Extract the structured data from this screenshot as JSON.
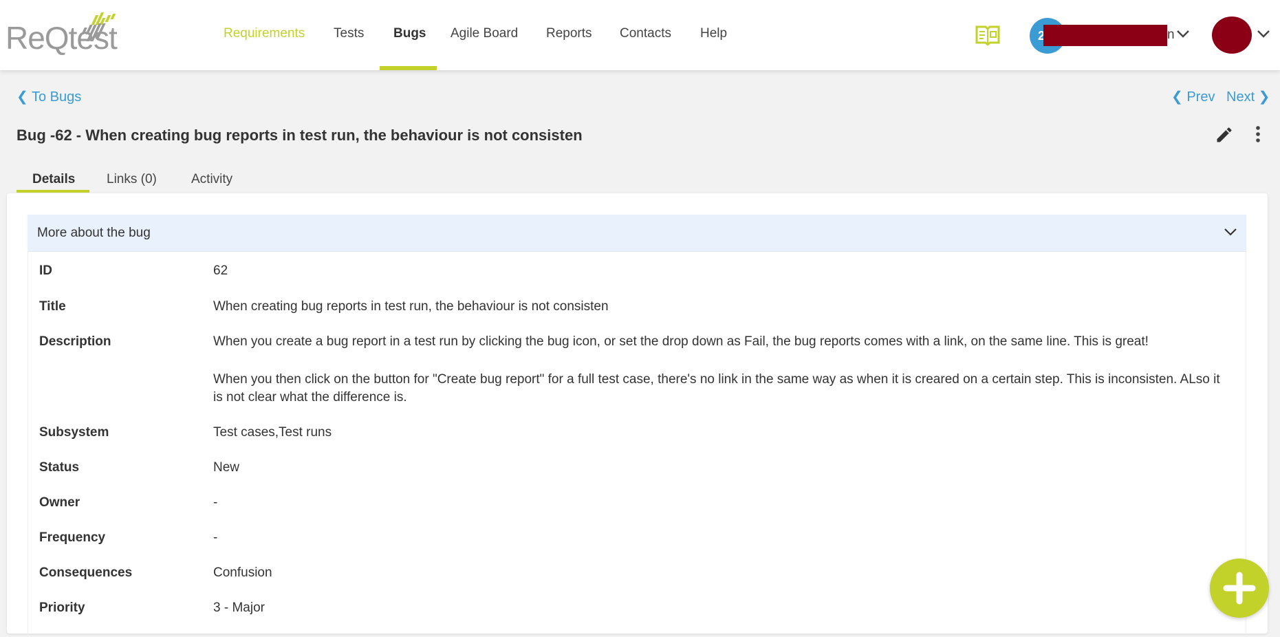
{
  "app": {
    "logo_text": "ReQtest",
    "brand_color": "#c3d12b",
    "link_color": "#3a9bd5"
  },
  "nav": {
    "items": [
      {
        "label": "Requirements"
      },
      {
        "label": "Tests"
      },
      {
        "label": "Bugs"
      },
      {
        "label": "Agile Board"
      },
      {
        "label": "Reports"
      },
      {
        "label": "Contacts"
      },
      {
        "label": "Help"
      }
    ]
  },
  "user": {
    "project_initial": "2",
    "project_name_tail": "n"
  },
  "page": {
    "back_label": "To Bugs",
    "prev_label": "Prev",
    "next_label": "Next",
    "title": "Bug -62 - When creating bug reports in test run, the behaviour is not consisten"
  },
  "tabs": [
    {
      "label": "Details"
    },
    {
      "label": "Links (0)"
    },
    {
      "label": "Activity"
    }
  ],
  "section": {
    "title": "More about the bug"
  },
  "fields": [
    {
      "label": "ID",
      "value": "62"
    },
    {
      "label": "Title",
      "value": "When creating bug reports in test run, the behaviour is not consisten"
    },
    {
      "label": "Description",
      "value": "When you create a bug report in a test run by clicking the bug icon, or set the drop down as Fail, the bug reports comes with a link, on the same line. This is great!",
      "value2": "When you then click on the button for \"Create bug report\" for a full test case, there's no link in the same way as when it is creared on a certain step. This is inconsisten. ALso it is not clear what the difference is."
    },
    {
      "label": "Subsystem",
      "value": "Test cases,Test runs"
    },
    {
      "label": "Status",
      "value": "New"
    },
    {
      "label": "Owner",
      "value": "-"
    },
    {
      "label": "Frequency",
      "value": "-"
    },
    {
      "label": "Consequences",
      "value": "Confusion"
    },
    {
      "label": "Priority",
      "value": "3 - Major"
    }
  ]
}
